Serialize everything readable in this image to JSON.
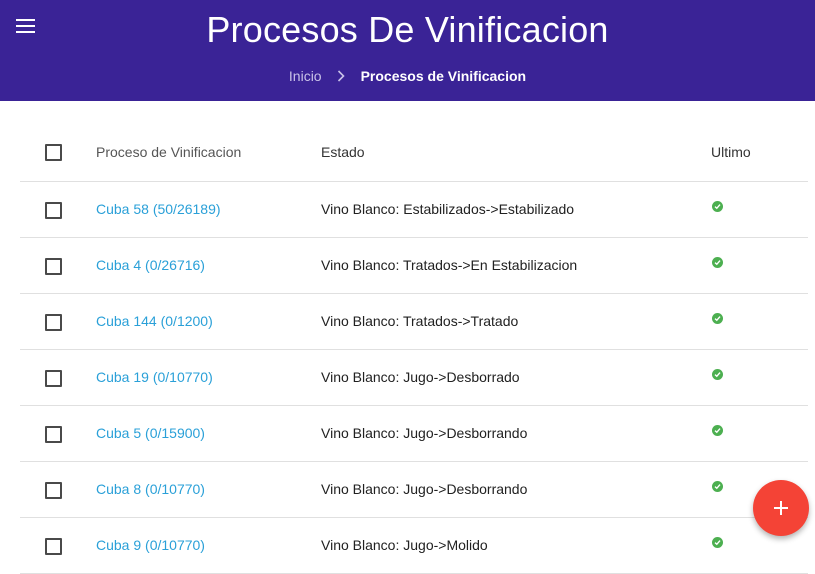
{
  "header": {
    "title": "Procesos De Vinificacion",
    "menu_icon": "menu-icon",
    "background_color": "#3a2396"
  },
  "breadcrumb": {
    "home": "Inicio",
    "separator_icon": "chevron-right-icon",
    "current": "Procesos de Vinificacion"
  },
  "table": {
    "columns": [
      "Proceso de Vinificacion",
      "Estado",
      "Ultimo"
    ],
    "rows": [
      {
        "name": "Cuba 58 (50/26189)",
        "state": "Vino Blanco: Estabilizados->Estabilizado",
        "last": true
      },
      {
        "name": "Cuba 4 (0/26716)",
        "state": "Vino Blanco: Tratados->En Estabilizacion",
        "last": true
      },
      {
        "name": "Cuba 144 (0/1200)",
        "state": "Vino Blanco: Tratados->Tratado",
        "last": true
      },
      {
        "name": "Cuba 19 (0/10770)",
        "state": "Vino Blanco: Jugo->Desborrado",
        "last": true
      },
      {
        "name": "Cuba 5 (0/15900)",
        "state": "Vino Blanco: Jugo->Desborrando",
        "last": true
      },
      {
        "name": "Cuba 8 (0/10770)",
        "state": "Vino Blanco: Jugo->Desborrando",
        "last": true
      },
      {
        "name": "Cuba 9 (0/10770)",
        "state": "Vino Blanco: Jugo->Molido",
        "last": true
      }
    ],
    "link_color": "#2aa0d8",
    "check_color": "#4caf50"
  },
  "fab": {
    "icon": "plus-icon",
    "color": "#f44336"
  }
}
